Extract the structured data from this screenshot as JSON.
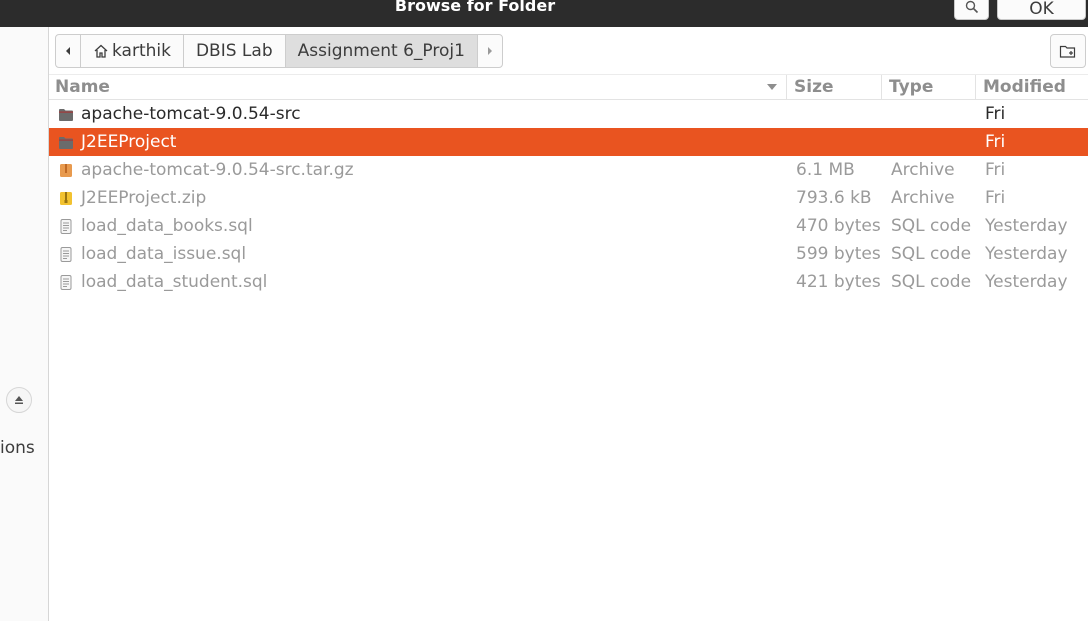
{
  "window": {
    "title": "Browse for Folder",
    "ok_label": "OK"
  },
  "sidebar": {
    "partial_label": "ions"
  },
  "pathbar": {
    "segments": [
      "karthik",
      "DBIS Lab",
      "Assignment 6_Proj1"
    ]
  },
  "columns": {
    "name": "Name",
    "size": "Size",
    "type": "Type",
    "modified": "Modified"
  },
  "files": [
    {
      "name": "apache-tomcat-9.0.54-src",
      "size": "",
      "type": "",
      "modified": "Fri",
      "icon": "folder-icon"
    },
    {
      "name": "J2EEProject",
      "size": "",
      "type": "",
      "modified": "Fri",
      "icon": "folder-icon"
    },
    {
      "name": "apache-tomcat-9.0.54-src.tar.gz",
      "size": "6.1 MB",
      "type": "Archive",
      "modified": "Fri",
      "icon": "archive-icon"
    },
    {
      "name": "J2EEProject.zip",
      "size": "793.6 kB",
      "type": "Archive",
      "modified": "Fri",
      "icon": "zip-icon"
    },
    {
      "name": "load_data_books.sql",
      "size": "470 bytes",
      "type": "SQL code",
      "modified": "Yesterday",
      "icon": "text-file-icon"
    },
    {
      "name": "load_data_issue.sql",
      "size": "599 bytes",
      "type": "SQL code",
      "modified": "Yesterday",
      "icon": "text-file-icon"
    },
    {
      "name": "load_data_student.sql",
      "size": "421 bytes",
      "type": "SQL code",
      "modified": "Yesterday",
      "icon": "text-file-icon"
    }
  ],
  "colors": {
    "selection": "#e95420",
    "headerbar": "#2c2c2c"
  }
}
